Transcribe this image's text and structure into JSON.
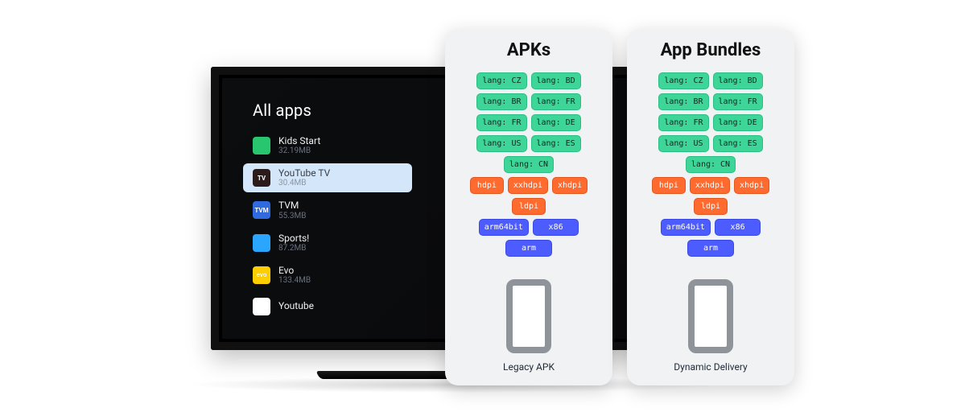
{
  "tv": {
    "section_title": "All apps",
    "apps": [
      {
        "name": "Kids Start",
        "size": "32.19MB",
        "icon_bg": "#28c76f",
        "icon_text": ""
      },
      {
        "name": "YouTube TV",
        "size": "30.4MB",
        "icon_bg": "#2b1b1b",
        "icon_text": "TV",
        "selected": true
      },
      {
        "name": "TVM",
        "size": "55.3MB",
        "icon_bg": "#2f6ae0",
        "icon_text": "TVM"
      },
      {
        "name": "Sports!",
        "size": "87.2MB",
        "icon_bg": "#2aa6ff",
        "icon_text": ""
      },
      {
        "name": "Evo",
        "size": "133.4MB",
        "icon_bg": "#ffce00",
        "icon_text": "evo"
      },
      {
        "name": "Youtube",
        "size": "",
        "icon_bg": "#ffffff",
        "icon_text": ""
      }
    ]
  },
  "cards": [
    {
      "title": "APKs",
      "caption": "Legacy APK",
      "langs": [
        "lang: CZ",
        "lang: BD",
        "lang: BR",
        "lang: FR",
        "lang: FR",
        "lang: DE",
        "lang: US",
        "lang: ES",
        "lang: CN"
      ],
      "dpis": [
        "hdpi",
        "xxhdpi",
        "xhdpi",
        "ldpi"
      ],
      "archs": [
        "arm64bit",
        "x86",
        "arm"
      ]
    },
    {
      "title": "App Bundles",
      "caption": "Dynamic Delivery",
      "langs": [
        "lang: CZ",
        "lang: BD",
        "lang: BR",
        "lang: FR",
        "lang: FR",
        "lang: DE",
        "lang: US",
        "lang: ES",
        "lang: CN"
      ],
      "dpis": [
        "hdpi",
        "xxhdpi",
        "xhdpi",
        "ldpi"
      ],
      "archs": [
        "arm64bit",
        "x86",
        "arm"
      ]
    }
  ],
  "colors": {
    "lang_chip": "#3ed598",
    "dpi_chip": "#ff6a2f",
    "arch_chip": "#4c5cff",
    "selected_row": "#d4e6f9"
  }
}
